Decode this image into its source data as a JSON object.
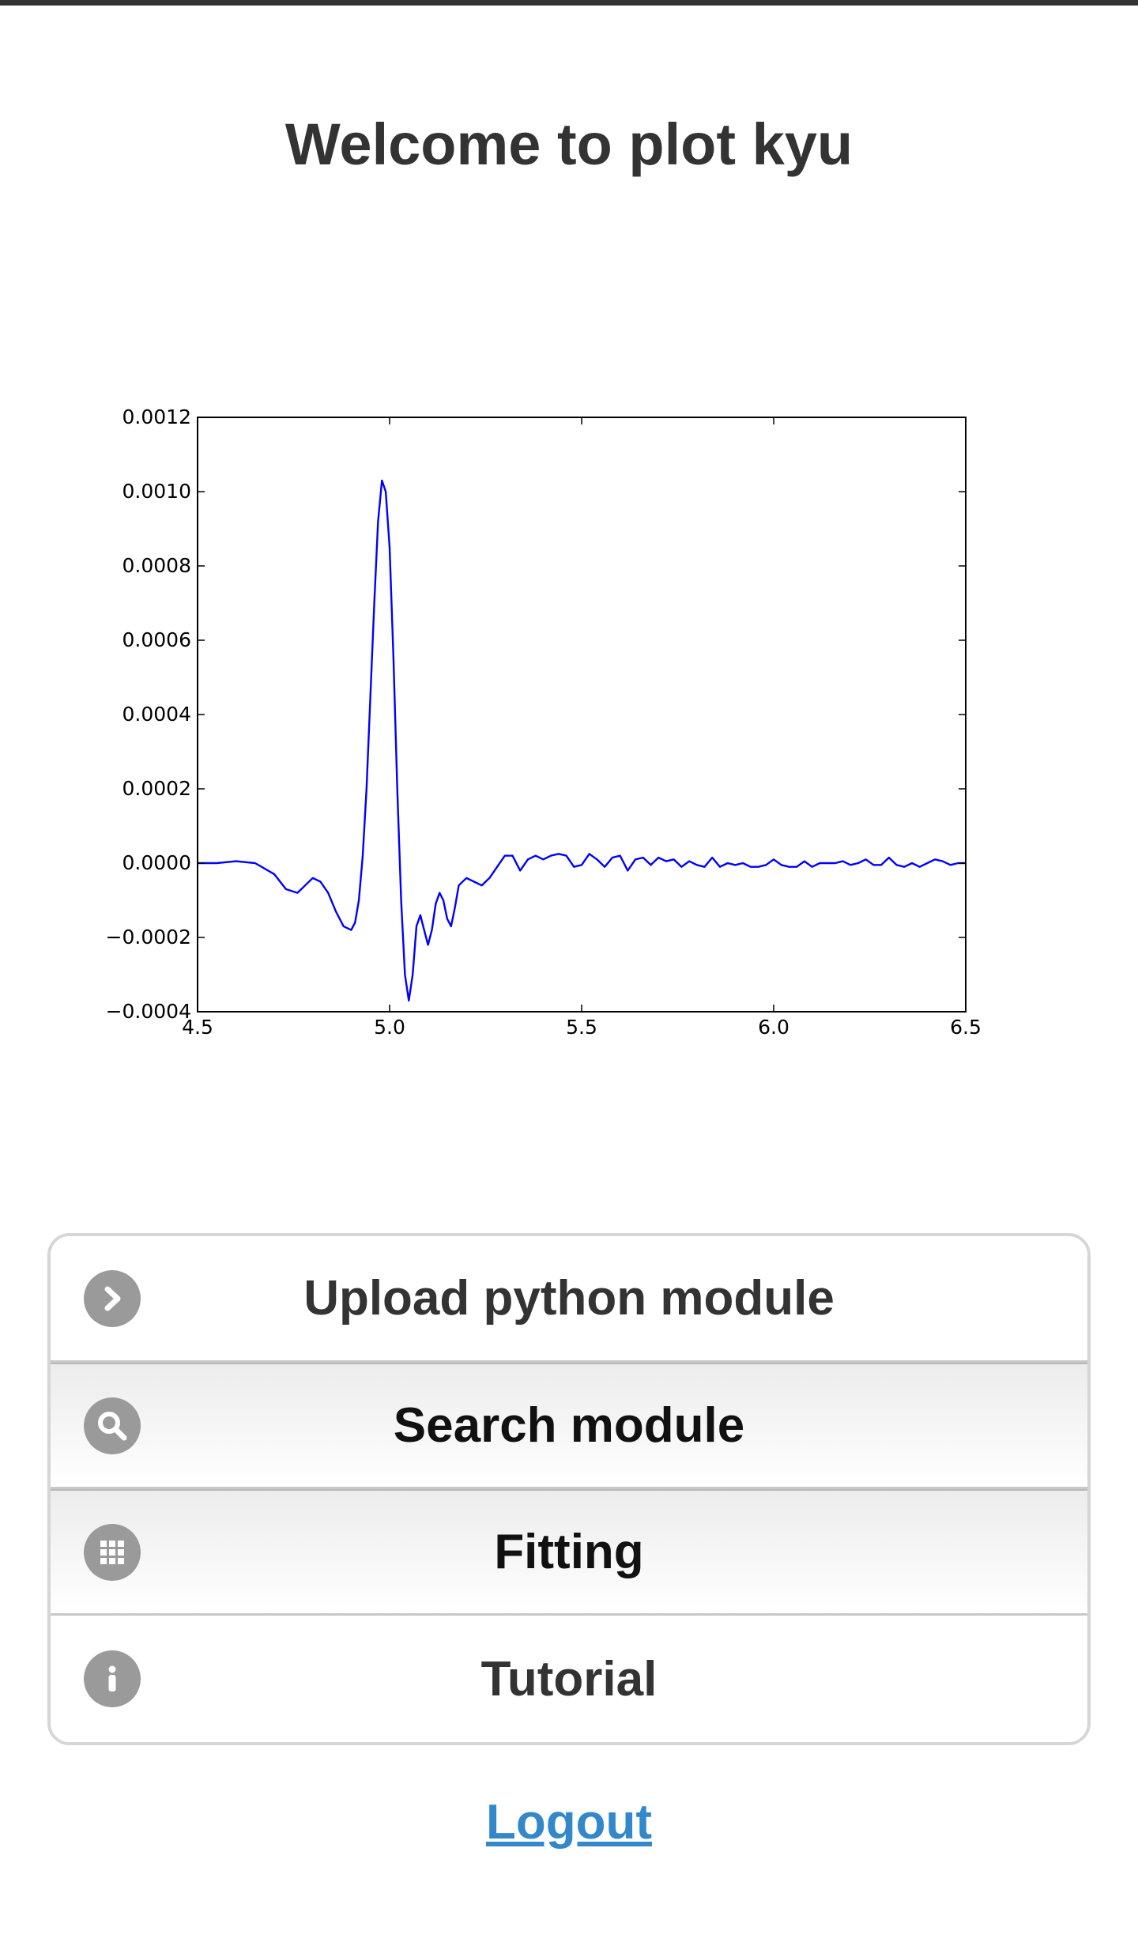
{
  "header": {
    "title": "Welcome to plot kyu"
  },
  "chart_data": {
    "type": "line",
    "title": "",
    "xlabel": "",
    "ylabel": "",
    "xlim": [
      4.5,
      6.5
    ],
    "ylim": [
      -0.0004,
      0.0012
    ],
    "grid": false,
    "line_color": "#0000ff",
    "x_ticks": [
      4.5,
      5.0,
      5.5,
      6.0,
      6.5
    ],
    "x_tick_labels": [
      "4.5",
      "5.0",
      "5.5",
      "6.0",
      "6.5"
    ],
    "y_ticks": [
      -0.0004,
      -0.0002,
      0.0,
      0.0002,
      0.0004,
      0.0006,
      0.0008,
      0.001,
      0.0012
    ],
    "y_tick_labels": [
      "−0.0004",
      "−0.0002",
      "0.0000",
      "0.0002",
      "0.0004",
      "0.0006",
      "0.0008",
      "0.0010",
      "0.0012"
    ],
    "series": [
      {
        "x": [
          4.5,
          4.55,
          4.6,
          4.65,
          4.7,
          4.73,
          4.76,
          4.78,
          4.8,
          4.82,
          4.84,
          4.86,
          4.88,
          4.9,
          4.91,
          4.92,
          4.93,
          4.94,
          4.95,
          4.96,
          4.97,
          4.98,
          4.99,
          5.0,
          5.01,
          5.02,
          5.03,
          5.04,
          5.05,
          5.06,
          5.07,
          5.08,
          5.09,
          5.1,
          5.11,
          5.12,
          5.13,
          5.14,
          5.15,
          5.16,
          5.17,
          5.18,
          5.2,
          5.22,
          5.24,
          5.26,
          5.28,
          5.3,
          5.32,
          5.34,
          5.36,
          5.38,
          5.4,
          5.42,
          5.44,
          5.46,
          5.48,
          5.5,
          5.52,
          5.54,
          5.56,
          5.58,
          5.6,
          5.62,
          5.64,
          5.66,
          5.68,
          5.7,
          5.72,
          5.74,
          5.76,
          5.78,
          5.8,
          5.82,
          5.84,
          5.86,
          5.88,
          5.9,
          5.92,
          5.94,
          5.96,
          5.98,
          6.0,
          6.02,
          6.04,
          6.06,
          6.08,
          6.1,
          6.12,
          6.14,
          6.16,
          6.18,
          6.2,
          6.22,
          6.24,
          6.26,
          6.28,
          6.3,
          6.32,
          6.34,
          6.36,
          6.38,
          6.4,
          6.42,
          6.44,
          6.46,
          6.48,
          6.5
        ],
        "y": [
          0.0,
          0.0,
          5e-06,
          0.0,
          -3e-05,
          -7e-05,
          -8e-05,
          -6e-05,
          -4e-05,
          -5e-05,
          -8e-05,
          -0.00013,
          -0.00017,
          -0.00018,
          -0.00016,
          -0.0001,
          2e-05,
          0.0002,
          0.00045,
          0.0007,
          0.00092,
          0.00103,
          0.001,
          0.00085,
          0.00055,
          0.0002,
          -0.0001,
          -0.0003,
          -0.00037,
          -0.0003,
          -0.00017,
          -0.00014,
          -0.00018,
          -0.00022,
          -0.00018,
          -0.00011,
          -8e-05,
          -0.0001,
          -0.00015,
          -0.00017,
          -0.00012,
          -6e-05,
          -4e-05,
          -5e-05,
          -6e-05,
          -4e-05,
          -1e-05,
          2e-05,
          2e-05,
          -2e-05,
          1e-05,
          2e-05,
          1e-05,
          2e-05,
          2.5e-05,
          2e-05,
          -1e-05,
          -5e-06,
          2.5e-05,
          1e-05,
          -1e-05,
          1.5e-05,
          2e-05,
          -2e-05,
          1e-05,
          1.5e-05,
          -5e-06,
          1.5e-05,
          5e-06,
          1e-05,
          -1e-05,
          5e-06,
          -5e-06,
          -1e-05,
          1.5e-05,
          -1e-05,
          0.0,
          -5e-06,
          0.0,
          -1e-05,
          -1e-05,
          -5e-06,
          1e-05,
          -5e-06,
          -1e-05,
          -1e-05,
          5e-06,
          -1e-05,
          0.0,
          0.0,
          0.0,
          5e-06,
          -5e-06,
          0.0,
          1e-05,
          -5e-06,
          -5e-06,
          1.5e-05,
          -5e-06,
          -1e-05,
          0.0,
          -1e-05,
          0.0,
          1e-05,
          5e-06,
          -5e-06,
          0.0,
          0.0
        ]
      }
    ]
  },
  "menu": {
    "items": [
      {
        "label": "Upload python module",
        "icon": "chevron-right-icon"
      },
      {
        "label": "Search module",
        "icon": "search-icon"
      },
      {
        "label": "Fitting",
        "icon": "grid-icon"
      },
      {
        "label": "Tutorial",
        "icon": "info-icon"
      }
    ]
  },
  "footer": {
    "logout_label": "Logout",
    "link_color": "#3388cc"
  }
}
